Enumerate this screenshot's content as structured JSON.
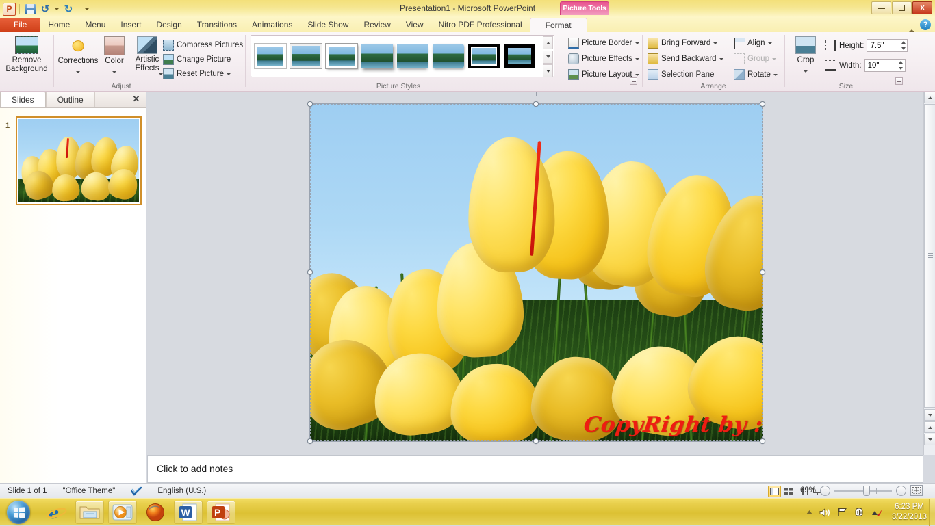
{
  "window": {
    "title": "Presentation1  -  Microsoft PowerPoint",
    "app_icon": "P",
    "minimize_label": "Minimize",
    "maximize_label": "Restore Down",
    "close_label": "X",
    "context_tab_group": "Picture Tools"
  },
  "quick_access": {
    "items": [
      {
        "name": "save",
        "label": "Save"
      },
      {
        "name": "undo",
        "label": "↶"
      },
      {
        "name": "undo-dropdown",
        "label": "▾"
      },
      {
        "name": "redo",
        "label": "↻"
      },
      {
        "name": "customize-qat",
        "label": "▾"
      }
    ]
  },
  "ribbon": {
    "tabs": [
      {
        "name": "file",
        "label": "File"
      },
      {
        "name": "home",
        "label": "Home"
      },
      {
        "name": "menu",
        "label": "Menu"
      },
      {
        "name": "insert",
        "label": "Insert"
      },
      {
        "name": "design",
        "label": "Design"
      },
      {
        "name": "transitions",
        "label": "Transitions"
      },
      {
        "name": "animations",
        "label": "Animations"
      },
      {
        "name": "slide-show",
        "label": "Slide Show"
      },
      {
        "name": "review",
        "label": "Review"
      },
      {
        "name": "view",
        "label": "View"
      },
      {
        "name": "nitro-pdf",
        "label": "Nitro PDF Professional"
      },
      {
        "name": "format",
        "label": "Format"
      }
    ],
    "active_tab": "Format",
    "minimize_ribbon_tooltip": "Minimize the Ribbon",
    "help_tooltip": "Microsoft PowerPoint Help",
    "groups": {
      "adjust": {
        "title": "Adjust",
        "remove_background": "Remove\nBackground",
        "remove_background_line1": "Remove",
        "remove_background_line2": "Background",
        "corrections": "Corrections",
        "color": "Color",
        "artistic_effects_line1": "Artistic",
        "artistic_effects_line2": "Effects",
        "compress_pictures": "Compress Pictures",
        "change_picture": "Change Picture",
        "reset_picture": "Reset Picture"
      },
      "picture_styles": {
        "title": "Picture Styles",
        "gallery_items": [
          "Simple Frame, White",
          "Beveled Matte, White",
          "Metal Frame",
          "Drop Shadow Rectangle",
          "Reflected Rounded Rectangle",
          "Soft Edge Rectangle",
          "Double Frame, Black",
          "Thick Matte, Black"
        ],
        "picture_border": "Picture Border",
        "picture_effects": "Picture Effects",
        "picture_layout": "Picture Layout"
      },
      "arrange": {
        "title": "Arrange",
        "bring_forward": "Bring Forward",
        "send_backward": "Send Backward",
        "selection_pane": "Selection Pane",
        "align": "Align",
        "group": "Group",
        "rotate": "Rotate"
      },
      "size": {
        "title": "Size",
        "crop": "Crop",
        "height_label": "Height:",
        "height_value": "7.5\"",
        "width_label": "Width:",
        "width_value": "10\""
      }
    }
  },
  "left_pane": {
    "tabs": [
      {
        "name": "slides",
        "label": "Slides",
        "active": true
      },
      {
        "name": "outline",
        "label": "Outline",
        "active": false
      }
    ],
    "close_label": "✕",
    "thumbnails": [
      {
        "number": "1",
        "alt": "Yellow tulips field slide"
      }
    ]
  },
  "slide": {
    "image_alt": "Field of yellow tulips against a blue sky",
    "watermark": "CopyRight by : @giangrahyu",
    "selected": true,
    "handles": 8
  },
  "notes": {
    "placeholder": "Click to add notes"
  },
  "status_bar": {
    "slide_counter": "Slide 1 of 1",
    "theme": "\"Office Theme\"",
    "spellcheck_icon": "spellcheck-icon",
    "language": "English (U.S.)",
    "view_buttons": [
      {
        "name": "normal-view",
        "label": "Normal",
        "active": true
      },
      {
        "name": "slide-sorter-view",
        "label": "Slide Sorter",
        "active": false
      },
      {
        "name": "reading-view",
        "label": "Reading View",
        "active": false
      },
      {
        "name": "slide-show-view",
        "label": "Slide Show",
        "active": false
      }
    ],
    "zoom_value": "69%",
    "zoom_out_label": "−",
    "zoom_in_label": "+",
    "fit_label": "Fit slide to current window"
  },
  "taskbar": {
    "start_label": "Start",
    "items": [
      {
        "name": "internet-explorer",
        "label": "Internet Explorer",
        "pinned": true,
        "framed": false
      },
      {
        "name": "windows-explorer",
        "label": "Windows Explorer",
        "pinned": true,
        "framed": true
      },
      {
        "name": "windows-media-player",
        "label": "Windows Media Player",
        "pinned": true,
        "framed": true
      },
      {
        "name": "mozilla-firefox",
        "label": "Mozilla Firefox",
        "pinned": true,
        "framed": false
      },
      {
        "name": "microsoft-word",
        "label": "Microsoft Word",
        "pinned": false,
        "framed": true
      },
      {
        "name": "microsoft-powerpoint",
        "label": "Microsoft PowerPoint",
        "pinned": false,
        "framed": true
      }
    ],
    "tray": [
      {
        "name": "show-hidden-icons",
        "label": "▴"
      },
      {
        "name": "volume-icon",
        "label": "Volume"
      },
      {
        "name": "network-icon",
        "label": "Network"
      },
      {
        "name": "action-center-icon",
        "label": "Action Center"
      },
      {
        "name": "antivirus-icon",
        "label": "Antivirus"
      }
    ],
    "clock_time": "6:23 PM",
    "clock_date": "3/22/2013"
  },
  "colors": {
    "accent_yellow": "#e9d04d",
    "file_tab_red": "#cf3f18",
    "context_pink": "#e8538f",
    "tulip_yellow": "#fdd83f",
    "watermark_red": "#ee1c12"
  }
}
